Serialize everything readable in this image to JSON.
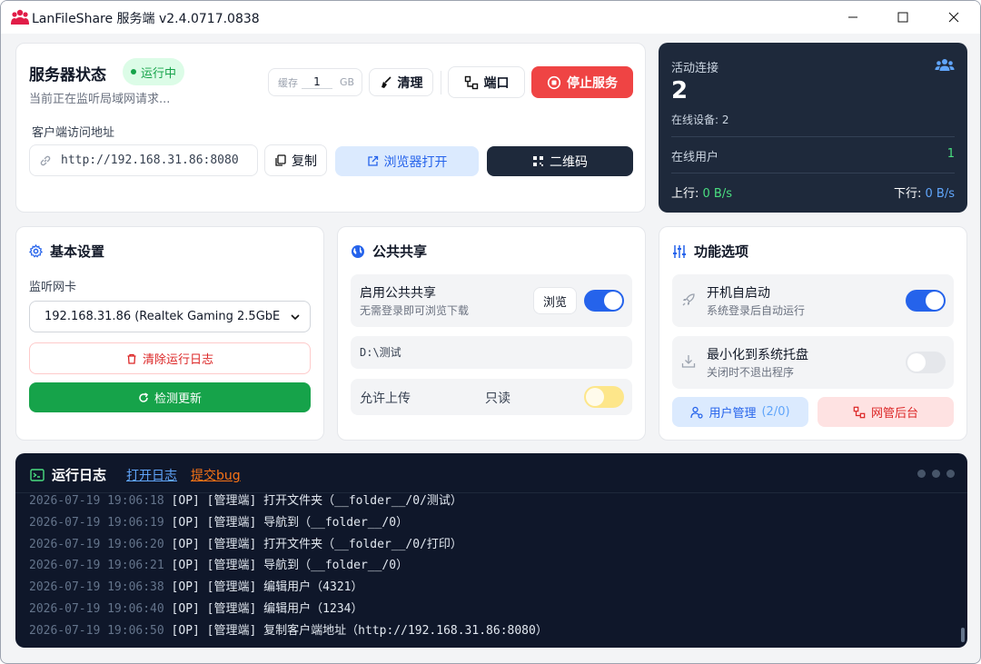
{
  "window": {
    "title": "LanFileShare 服务端 v2.4.0717.0838"
  },
  "status": {
    "title": "服务器状态",
    "badge": "运行中",
    "subtitle": "当前正在监听局域网请求...",
    "cache_label": "缓存",
    "cache_value": "1",
    "cache_unit": "GB",
    "clean_label": "清理",
    "port_label": "端口",
    "stop_label": "停止服务",
    "addr_label": "客户端访问地址",
    "addr_value": "http://192.168.31.86:8080",
    "copy_label": "复制",
    "browser_label": "浏览器打开",
    "qr_label": "二维码"
  },
  "activity": {
    "label": "活动连接",
    "count": "2",
    "devices": "在线设备: 2",
    "users_label": "在线用户",
    "users_value": "1",
    "up_label": "上行:",
    "up_value": "0 B/s",
    "down_label": "下行:",
    "down_value": "0 B/s"
  },
  "basic": {
    "title": "基本设置",
    "nic_label": "监听网卡",
    "nic_value": "192.168.31.86 (Realtek Gaming 2.5GbE",
    "clear_log_label": "清除运行日志",
    "update_label": "检测更新"
  },
  "share": {
    "title": "公共共享",
    "enable_title": "启用公共共享",
    "enable_desc": "无需登录即可浏览下载",
    "browse_label": "浏览",
    "enabled": true,
    "path": "D:\\测试",
    "upload_label": "允许上传",
    "readonly_label": "只读",
    "upload_enabled": false
  },
  "func": {
    "title": "功能选项",
    "autostart_title": "开机自启动",
    "autostart_desc": "系统登录后自动运行",
    "autostart_enabled": true,
    "tray_title": "最小化到系统托盘",
    "tray_desc": "关闭时不退出程序",
    "tray_enabled": false,
    "users_label": "用户管理",
    "users_count": "(2/0)",
    "netadmin_label": "网管后台"
  },
  "log": {
    "title": "运行日志",
    "open_label": "打开日志",
    "bug_label": "提交bug",
    "lines": [
      {
        "ts": "2026-07-19 19:06:18",
        "msg": "[OP] [管理端] 打开文件夹（__folder__/0/测试）"
      },
      {
        "ts": "2026-07-19 19:06:19",
        "msg": "[OP] [管理端] 导航到（__folder__/0）"
      },
      {
        "ts": "2026-07-19 19:06:20",
        "msg": "[OP] [管理端] 打开文件夹（__folder__/0/打印）"
      },
      {
        "ts": "2026-07-19 19:06:21",
        "msg": "[OP] [管理端] 导航到（__folder__/0）"
      },
      {
        "ts": "2026-07-19 19:06:38",
        "msg": "[OP] [管理端] 编辑用户（4321）"
      },
      {
        "ts": "2026-07-19 19:06:40",
        "msg": "[OP] [管理端] 编辑用户（1234）"
      },
      {
        "ts": "2026-07-19 19:06:50",
        "msg": "[OP] [管理端] 复制客户端地址（http://192.168.31.86:8080）"
      }
    ]
  },
  "colors": {
    "accent": "#2563eb",
    "danger": "#ef4444",
    "success": "#16a34a",
    "dark": "#1e293b",
    "log_bg": "#0f172a"
  }
}
